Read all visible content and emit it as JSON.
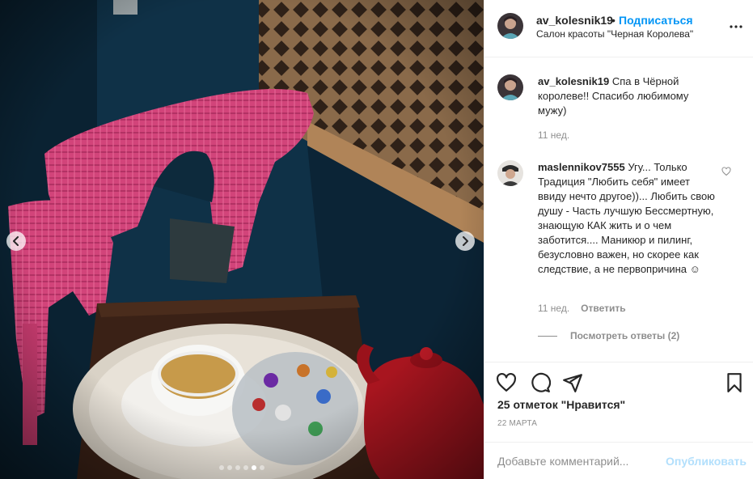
{
  "post": {
    "username": "av_kolesnik19",
    "follow_separator": "•",
    "follow_label": "Подписаться",
    "location": "Салон красоты \"Черная Королева\""
  },
  "carousel": {
    "slide_count": 6,
    "active_slide": 5,
    "prev_icon": "chevron-left-icon",
    "next_icon": "chevron-right-icon"
  },
  "caption": {
    "username": "av_kolesnik19",
    "text": "Спа в Чёрной королеве!! Спасибо любимому мужу)",
    "time": "11 нед."
  },
  "comments": [
    {
      "username": "maslennikov7555",
      "text": "Угу... Только Традиция \"Любить себя\" имеет ввиду нечто другое))... Любить свою душу - Часть лучшую Бессмертную, знающую КАК жить и о чем заботится.... Маникюр и пилинг, безусловно важен, но скорее как следствие, а не первопричина ☺",
      "time": "11 нед.",
      "reply_label": "Ответить",
      "view_replies": "Посмотреть ответы (2)"
    }
  ],
  "actions": {
    "icons": [
      "heart-icon",
      "comment-icon",
      "share-icon",
      "bookmark-icon"
    ]
  },
  "likes_text": "25 отметок \"Нравится\"",
  "date_text": "22 МАРТА",
  "add_comment": {
    "placeholder": "Добавьте комментарий...",
    "publish_label": "Опубликовать"
  },
  "colors": {
    "link_blue": "#0095f6",
    "publish_disabled": "#b2dffc",
    "secondary_text": "#8e8e8e",
    "divider": "#efefef"
  }
}
